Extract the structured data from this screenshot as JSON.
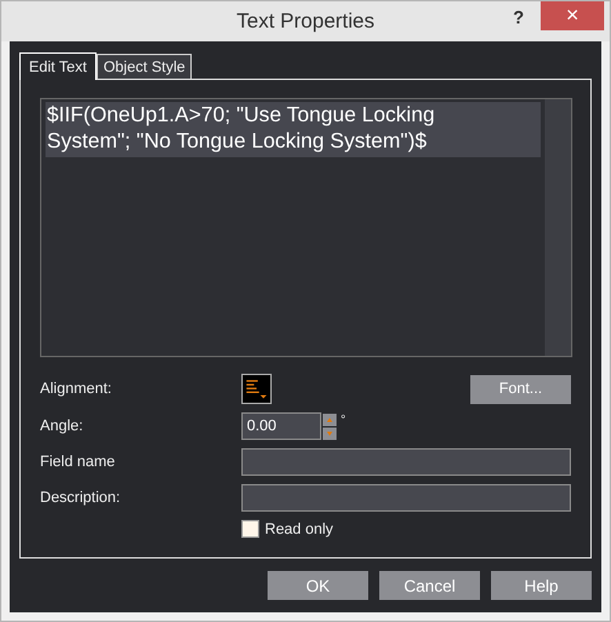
{
  "window": {
    "title": "Text Properties",
    "help_glyph": "?",
    "close_glyph": "×"
  },
  "tabs": [
    {
      "label": "Edit Text",
      "selected": true
    },
    {
      "label": "Object Style",
      "selected": false
    }
  ],
  "editor": {
    "value": "$IIF(OneUp1.A>70; \"Use Tongue Locking System\"; \"No Tongue Locking System\")$",
    "selected": true
  },
  "form": {
    "alignment_label": "Alignment:",
    "font_button": "Font...",
    "angle_label": "Angle:",
    "angle_value": "0.00",
    "degree": "°",
    "field_name_label": "Field name",
    "description_label": "Description:"
  },
  "read_only": {
    "label": "Read only",
    "checked": false
  },
  "buttons": [
    "OK",
    "Cancel",
    "Help"
  ]
}
